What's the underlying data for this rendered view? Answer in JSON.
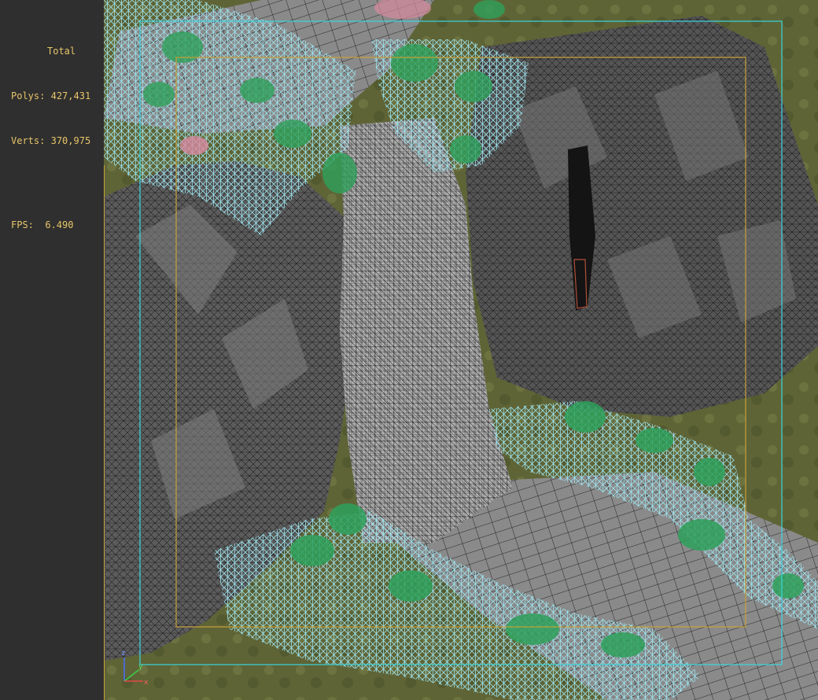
{
  "stats": {
    "title": "Total",
    "polys_label": "Polys:",
    "polys_value": "427,431",
    "verts_label": "Verts:",
    "verts_value": "370,975",
    "fps_label": "FPS:",
    "fps_value": "6.490"
  },
  "axis": {
    "z": "z",
    "y": "y",
    "x": "x"
  },
  "colors": {
    "stats_text": "#e7c56a",
    "panel_bg": "#2f2f2f",
    "ground": "#6b6a3a",
    "rock": "#5a5a5a",
    "wire_foliage": "#8fe0ef",
    "foliage_fill": "#2ea05a",
    "safe_frame_outer": "#3ad6e0",
    "safe_frame_inner": "#c8a13a"
  }
}
